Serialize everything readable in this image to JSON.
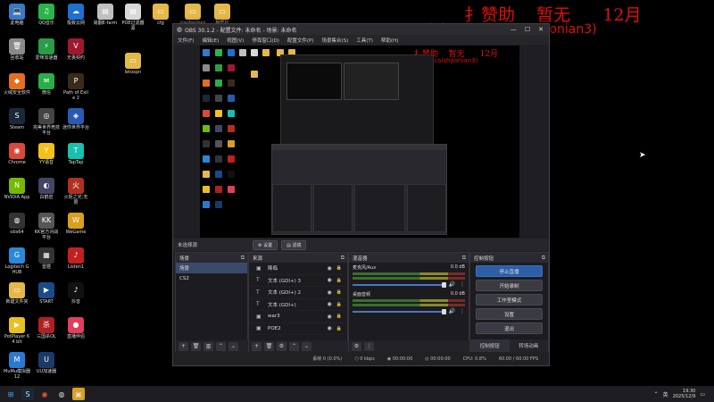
{
  "desktop": {
    "icons": [
      {
        "label": "此电脑",
        "color": "#3a78c8",
        "glyph": "💻",
        "icon": "computer-icon"
      },
      {
        "label": "QQ音乐",
        "color": "#2bb44a",
        "glyph": "♫",
        "icon": "music-icon"
      },
      {
        "label": "极致云网",
        "color": "#1f6fd0",
        "glyph": "☁",
        "icon": "cloud-icon"
      },
      {
        "label": "易翻E-farm",
        "color": "#c0c0c0",
        "glyph": "▤",
        "icon": "file-icon"
      },
      {
        "label": "POE过滤器源",
        "color": "#d8d8d8",
        "glyph": "▤",
        "icon": "file-icon"
      },
      {
        "label": "cfg",
        "color": "#e5b84a",
        "glyph": "▭",
        "icon": "folder-icon"
      },
      {
        "label": "xiaobenben",
        "color": "#e5b84a",
        "glyph": "▭",
        "icon": "folder-icon"
      },
      {
        "label": "魅帮社",
        "color": "#e5b84a",
        "glyph": "▭",
        "icon": "folder-icon"
      },
      {
        "label": "回收站",
        "color": "#8a8a8a",
        "glyph": "🗑",
        "icon": "recycle-bin-icon"
      },
      {
        "label": "爱咪加速器",
        "color": "#2b9d48",
        "glyph": "⚡",
        "icon": "accelerator-icon"
      },
      {
        "label": "无畏契约",
        "color": "#a01830",
        "glyph": "V",
        "icon": "valorant-icon"
      },
      {
        "label": "letoxpn",
        "color": "#e5b84a",
        "glyph": "▭",
        "icon": "folder-icon"
      },
      {
        "label": "火绒安全软件",
        "color": "#e27020",
        "glyph": "◆",
        "icon": "shield-icon"
      },
      {
        "label": "微信",
        "color": "#2aae48",
        "glyph": "✉",
        "icon": "wechat-icon"
      },
      {
        "label": "Path of Exile 2",
        "color": "#3a2a1a",
        "glyph": "P",
        "icon": "game-icon"
      },
      {
        "label": "Steam",
        "color": "#1b2838",
        "glyph": "S",
        "icon": "steam-icon"
      },
      {
        "label": "完美世界竞技平台",
        "color": "#444",
        "glyph": "◎",
        "icon": "game-platform-icon"
      },
      {
        "label": "迷你世界平台",
        "color": "#2a5ab0",
        "glyph": "◈",
        "icon": "game-icon"
      },
      {
        "label": "Chrome",
        "color": "#d94a3a",
        "glyph": "◉",
        "icon": "chrome-icon"
      },
      {
        "label": "YY语音",
        "color": "#f2c21a",
        "glyph": "Y",
        "icon": "yy-icon"
      },
      {
        "label": "TapTap",
        "color": "#18c0b0",
        "glyph": "T",
        "icon": "taptap-icon"
      },
      {
        "label": "NVIDIA App",
        "color": "#76b900",
        "glyph": "N",
        "icon": "nvidia-icon"
      },
      {
        "label": "白鹤岩",
        "color": "#446",
        "glyph": "◐",
        "icon": "game-icon"
      },
      {
        "label": "火炬之光:无限",
        "color": "#b03020",
        "glyph": "火",
        "icon": "game-icon"
      },
      {
        "label": "obs64",
        "color": "#333",
        "glyph": "◍",
        "icon": "obs-icon"
      },
      {
        "label": "KK官方对战平台",
        "color": "#555",
        "glyph": "KK",
        "icon": "game-platform-icon"
      },
      {
        "label": "WeGame",
        "color": "#d8a020",
        "glyph": "W",
        "icon": "wegame-icon"
      },
      {
        "label": "Logitech G HUB",
        "color": "#2a88d8",
        "glyph": "G",
        "icon": "logitech-icon"
      },
      {
        "label": "雷霆",
        "color": "#333",
        "glyph": "▦",
        "icon": "app-icon"
      },
      {
        "label": "Listen1",
        "color": "#c02020",
        "glyph": "♪",
        "icon": "music-icon"
      },
      {
        "label": "新建文件夹",
        "color": "#e5b84a",
        "glyph": "▭",
        "icon": "folder-icon"
      },
      {
        "label": "START",
        "color": "#1a4a8a",
        "glyph": "▶",
        "icon": "start-icon"
      },
      {
        "label": "抖音",
        "color": "#111",
        "glyph": "♪",
        "icon": "douyin-icon"
      },
      {
        "label": "PotPlayer 64 bit",
        "color": "#e8c020",
        "glyph": "▶",
        "icon": "player-icon"
      },
      {
        "label": "三国杀OL",
        "color": "#b02020",
        "glyph": "杀",
        "icon": "game-icon"
      },
      {
        "label": "直播伴侣",
        "color": "#e0405a",
        "glyph": "●",
        "icon": "live-icon"
      },
      {
        "label": "MuMu模拟器12",
        "color": "#2a7ad0",
        "glyph": "M",
        "icon": "emulator-icon"
      },
      {
        "label": "UU加速器",
        "color": "#1a3a6a",
        "glyph": "U",
        "icon": "accelerator-icon"
      }
    ],
    "overlay_line1": "扌赞助    暂无      12月",
    "overlay_line2": "X充电+ V ( tiancaishaonian3)"
  },
  "obs": {
    "title": "OBS 30.1.2 - 配置文件: 未命名 - 场景: 未命名",
    "menu": [
      "文件(F)",
      "编辑(E)",
      "视图(V)",
      "停靠窗口(D)",
      "配置文件(P)",
      "场景集合(S)",
      "工具(T)",
      "帮助(H)"
    ],
    "no_source_label": "未选择源",
    "properties_button": "⚙ 设置",
    "filters_button": "▤ 滤镜",
    "scenes": {
      "header": "场景",
      "items": [
        "场景",
        "CS2"
      ],
      "selected": 0
    },
    "sources": {
      "header": "来源",
      "items": [
        {
          "name": "降临",
          "icon": "▣"
        },
        {
          "name": "文本 (GDI+) 3",
          "icon": "T"
        },
        {
          "name": "文本 (GDI+) 2",
          "icon": "T"
        },
        {
          "name": "文本 (GDI+)",
          "icon": "T"
        },
        {
          "name": "war3",
          "icon": "▣"
        },
        {
          "name": "POE2",
          "icon": "▣"
        }
      ]
    },
    "mixer": {
      "header": "混音器",
      "tracks": [
        {
          "name": "麦克风/Aux",
          "db": "0.0 dB"
        },
        {
          "name": "桌面音频",
          "db": "0.0 dB"
        }
      ]
    },
    "controls": {
      "header": "控制按钮",
      "buttons": [
        "停止直播",
        "开始录制",
        "工作室模式",
        "设置",
        "退出"
      ],
      "tabs": [
        "控制按钮",
        "转场动画"
      ]
    },
    "status": {
      "dropped": "丢帧 0 (0.0%)",
      "bitrate": "0 kbps",
      "live_time": "00:00:00",
      "rec_time": "00:00:00",
      "cpu": "CPU: 0.8%",
      "fps": "60.00 / 60.00 FPS"
    }
  },
  "taskbar": {
    "time": "19:30",
    "date": "2025/12/9",
    "ime": "英"
  },
  "colors": {
    "accent": "#2c5fa8",
    "overlay_red": "#e01010"
  }
}
